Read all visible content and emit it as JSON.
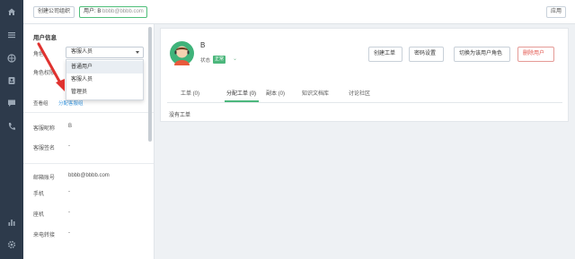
{
  "topbar": {
    "create_org": "创建公司组织",
    "user_prefix": "用户: B",
    "user_email": "bbbb@bbbb.com",
    "apply": "应用"
  },
  "rail": {
    "icons": [
      "home-icon",
      "list-icon",
      "globe-icon",
      "contact-card-icon",
      "message-icon",
      "phone-icon",
      "bar-chart-icon",
      "gear-icon"
    ],
    "background": "#2d3a4b"
  },
  "panel": {
    "title": "用户信息",
    "role_label": "角色",
    "role_value": "客服人员",
    "role_options": [
      "普通用户",
      "客服人员",
      "管理员"
    ],
    "permission_label": "角色权限",
    "detail_label": "查看组",
    "detail_link": "分配客服组",
    "nickname_label": "客服昵称",
    "nickname_value": "B",
    "signature_label": "客服签名",
    "signature_value": "-",
    "email_label": "邮箱账号",
    "email_value": "bbbb@bbbb.com",
    "phone_label": "手机",
    "phone_value": "-",
    "landline_label": "座机",
    "landline_value": "-",
    "transfer_label": "来电转接",
    "transfer_value": "-"
  },
  "profile": {
    "name": "B",
    "status_label": "状态",
    "status_badge": "正常",
    "buttons": {
      "create_ticket": "创建工单",
      "password": "密码设置",
      "switch_role": "切换为该用户角色",
      "delete_user": "删除用户"
    },
    "tabs": [
      "工单 (0)",
      "分配工单 (0)",
      "副本 (0)",
      "知识文档库",
      "讨论社区"
    ],
    "active_tab": "分配工单 (0)",
    "empty_text": "没有工单"
  },
  "colors": {
    "accent_green": "#4cb77c",
    "danger_red": "#e2544c",
    "link_blue": "#3b98e0",
    "arrow_red": "#e0322f"
  }
}
